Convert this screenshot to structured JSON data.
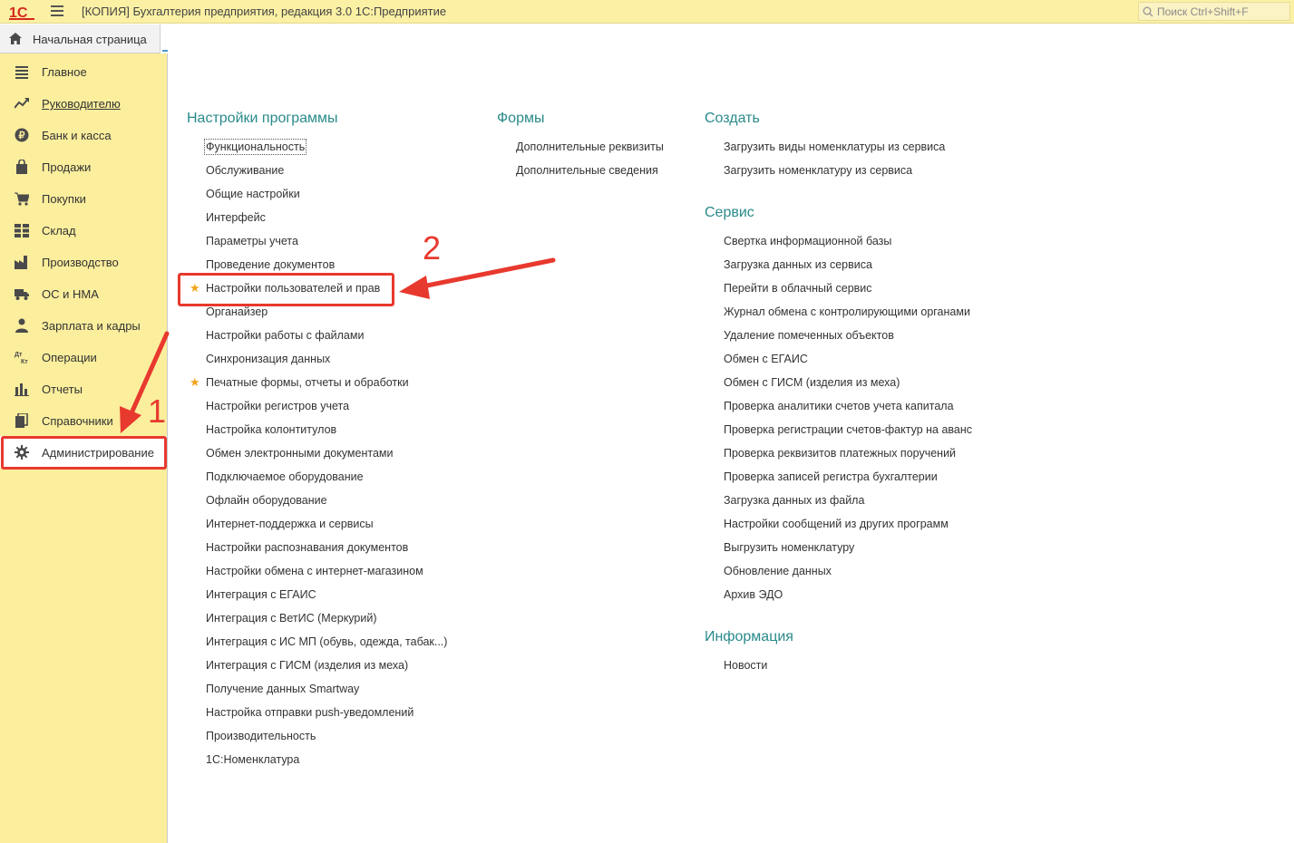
{
  "window": {
    "title": "[КОПИЯ] Бухгалтерия предприятия, редакция 3.0 1С:Предприятие",
    "search_placeholder": "Поиск Ctrl+Shift+F"
  },
  "home_tab": {
    "label": "Начальная страница"
  },
  "sidebar": {
    "items": [
      {
        "label": "Главное",
        "icon": "list-icon"
      },
      {
        "label": "Руководителю",
        "icon": "trend-icon"
      },
      {
        "label": "Банк и касса",
        "icon": "ruble-icon"
      },
      {
        "label": "Продажи",
        "icon": "bag-icon"
      },
      {
        "label": "Покупки",
        "icon": "cart-icon"
      },
      {
        "label": "Склад",
        "icon": "grid-icon"
      },
      {
        "label": "Производство",
        "icon": "factory-icon"
      },
      {
        "label": "ОС и НМА",
        "icon": "truck-icon"
      },
      {
        "label": "Зарплата и кадры",
        "icon": "person-icon"
      },
      {
        "label": "Операции",
        "icon": "dt-kt-icon"
      },
      {
        "label": "Отчеты",
        "icon": "bar-chart-icon"
      },
      {
        "label": "Справочники",
        "icon": "books-icon"
      },
      {
        "label": "Администрирование",
        "icon": "gear-icon"
      }
    ]
  },
  "content": {
    "settings": {
      "title": "Настройки программы",
      "items": [
        "Функциональность",
        "Обслуживание",
        "Общие настройки",
        "Интерфейс",
        "Параметры учета",
        "Проведение документов",
        "Настройки пользователей и прав",
        "Органайзер",
        "Настройки работы с файлами",
        "Синхронизация данных",
        "Печатные формы, отчеты и обработки",
        "Настройки регистров учета",
        "Настройка колонтитулов",
        "Обмен электронными документами",
        "Подключаемое оборудование",
        "Офлайн оборудование",
        "Интернет-поддержка и сервисы",
        "Настройки распознавания документов",
        "Настройки обмена с интернет-магазином",
        "Интеграция с ЕГАИС",
        "Интеграция с ВетИС (Меркурий)",
        "Интеграция с ИС МП (обувь, одежда, табак...)",
        "Интеграция с ГИСМ (изделия из меха)",
        "Получение данных Smartway",
        "Настройка отправки push-уведомлений",
        "Производительность",
        "1С:Номенклатура"
      ]
    },
    "forms": {
      "title": "Формы",
      "items": [
        "Дополнительные реквизиты",
        "Дополнительные сведения"
      ]
    },
    "create": {
      "title": "Создать",
      "items": [
        "Загрузить виды номенклатуры из сервиса",
        "Загрузить номенклатуру из сервиса"
      ]
    },
    "service": {
      "title": "Сервис",
      "items": [
        "Свертка информационной базы",
        "Загрузка данных из сервиса",
        "Перейти в облачный сервис",
        "Журнал обмена с контролирующими органами",
        "Удаление помеченных объектов",
        "Обмен с ЕГАИС",
        "Обмен с ГИСМ (изделия из меха)",
        "Проверка аналитики счетов учета капитала",
        "Проверка регистрации счетов-фактур на аванс",
        "Проверка реквизитов платежных поручений",
        "Проверка записей регистра бухгалтерии",
        "Загрузка данных из файла",
        "Настройки сообщений из других программ",
        "Выгрузить номенклатуру",
        "Обновление данных",
        "Архив ЭДО"
      ]
    },
    "info": {
      "title": "Информация",
      "items": [
        "Новости"
      ]
    }
  },
  "annotations": {
    "step1": "1",
    "step2": "2",
    "color": "#e8392e"
  },
  "colors": {
    "sidebar_bg": "#fbee9d",
    "titlebar_bg": "#fbf0a4",
    "section_title": "#2a8a8a",
    "star": "#f2a51b"
  }
}
